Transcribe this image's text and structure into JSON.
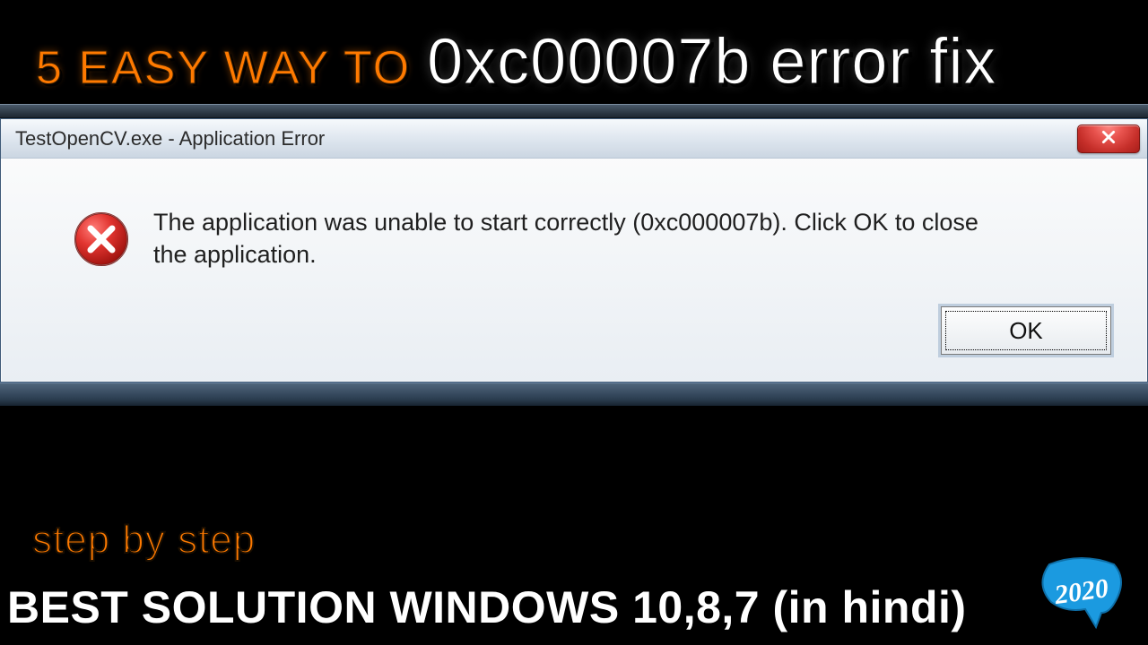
{
  "headline": {
    "lead": "5 EASY WAY TO",
    "main": "0xc00007b error fix"
  },
  "dialog": {
    "title": "TestOpenCV.exe - Application Error",
    "message": "The application was unable to start correctly (0xc000007b). Click OK to close the application.",
    "ok_label": "OK"
  },
  "captions": {
    "step": "step by step",
    "footer": "BEST SOLUTION WINDOWS 10,8,7 (in hindi)"
  },
  "badge": {
    "year": "2020"
  },
  "colors": {
    "accent_orange": "#ff7a00",
    "close_red": "#c62f2a",
    "badge_blue": "#1b9ae0"
  }
}
